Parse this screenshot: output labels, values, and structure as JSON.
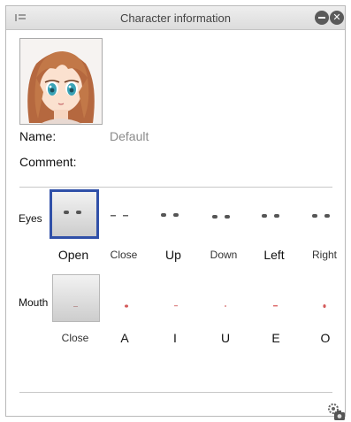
{
  "window": {
    "title": "Character information"
  },
  "character": {
    "name_label": "Name:",
    "name_value": "Default",
    "comment_label": "Comment:"
  },
  "eyes": {
    "label": "Eyes",
    "options": [
      "Open",
      "Close",
      "Up",
      "Down",
      "Left",
      "Right"
    ],
    "selected": "Open"
  },
  "mouth": {
    "label": "Mouth",
    "options": [
      "Close",
      "A",
      "I",
      "U",
      "E",
      "O"
    ]
  },
  "icons": {
    "grip": "grip-icon",
    "minimize": "minimize-icon",
    "close": "close-icon",
    "settings": "settings-camera-icon"
  },
  "colors": {
    "selection_border": "#3050a8",
    "title_bar": "#e4e4e4",
    "value_text": "#8a8a8a"
  }
}
